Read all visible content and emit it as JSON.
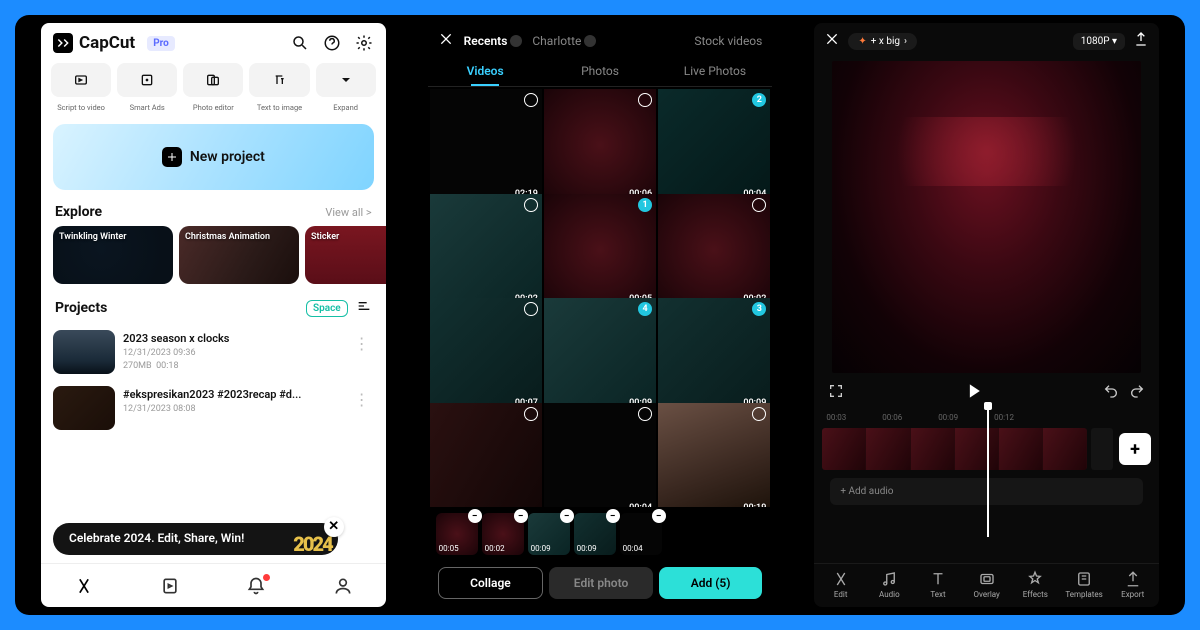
{
  "screen1": {
    "app_name": "CapCut",
    "pro_badge": "Pro",
    "tools": {
      "labels": [
        "Script to video",
        "Smart Ads",
        "Photo editor",
        "Text to image",
        "Expand"
      ]
    },
    "new_project": "New project",
    "explore": {
      "title": "Explore",
      "view_all": "View all  >",
      "cards": [
        "Twinkling Winter",
        "Christmas Animation",
        "Sticker"
      ]
    },
    "projects": {
      "title": "Projects",
      "space_badge": "Space",
      "list": [
        {
          "title": "2023 season x clocks",
          "date": "12/31/2023 09:36",
          "size": "270MB",
          "duration": "00:18"
        },
        {
          "title": "#ekspresikan2023 #2023recap #d...",
          "date": "12/31/2023 08:08",
          "size": "",
          "duration": ""
        }
      ]
    },
    "promo": {
      "text": "Celebrate 2024. Edit, Share, Win!",
      "art": "2024"
    }
  },
  "screen2": {
    "sources": [
      "Recents",
      "Charlotte",
      "Stock videos"
    ],
    "tabs": [
      "Videos",
      "Photos",
      "Live Photos"
    ],
    "active_tab": 0,
    "grid_durations": [
      "02:19",
      "00:06",
      "00:04",
      "00:02",
      "00:05",
      "00:02",
      "00:07",
      "00:09",
      "00:09",
      "",
      "00:04",
      "00:19"
    ],
    "selected_indices": {
      "2": "2",
      "4": "1",
      "7": "4",
      "8": "3"
    },
    "tray_durations": [
      "00:05",
      "00:02",
      "00:09",
      "00:09",
      "00:04"
    ],
    "actions": {
      "collage": "Collage",
      "edit": "Edit photo",
      "add": "Add (5)"
    }
  },
  "screen3": {
    "title": "+ x big",
    "resolution": "1080P",
    "ruler": [
      "00:03",
      "00:06",
      "00:09",
      "00:12"
    ],
    "add_audio": "+  Add audio",
    "tools": [
      "Edit",
      "Audio",
      "Text",
      "Overlay",
      "Effects",
      "Templates",
      "Export"
    ]
  }
}
